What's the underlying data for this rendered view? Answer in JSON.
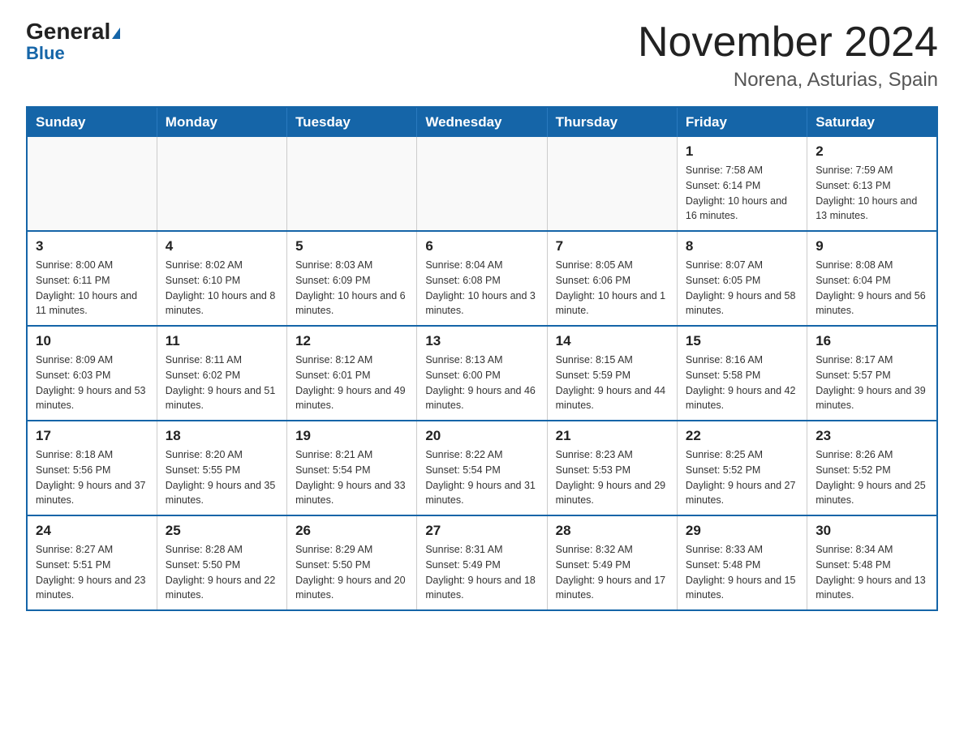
{
  "header": {
    "logo_general": "General",
    "logo_blue": "Blue",
    "title": "November 2024",
    "subtitle": "Norena, Asturias, Spain"
  },
  "calendar": {
    "weekdays": [
      "Sunday",
      "Monday",
      "Tuesday",
      "Wednesday",
      "Thursday",
      "Friday",
      "Saturday"
    ],
    "weeks": [
      [
        {
          "day": "",
          "info": ""
        },
        {
          "day": "",
          "info": ""
        },
        {
          "day": "",
          "info": ""
        },
        {
          "day": "",
          "info": ""
        },
        {
          "day": "",
          "info": ""
        },
        {
          "day": "1",
          "info": "Sunrise: 7:58 AM\nSunset: 6:14 PM\nDaylight: 10 hours and 16 minutes."
        },
        {
          "day": "2",
          "info": "Sunrise: 7:59 AM\nSunset: 6:13 PM\nDaylight: 10 hours and 13 minutes."
        }
      ],
      [
        {
          "day": "3",
          "info": "Sunrise: 8:00 AM\nSunset: 6:11 PM\nDaylight: 10 hours and 11 minutes."
        },
        {
          "day": "4",
          "info": "Sunrise: 8:02 AM\nSunset: 6:10 PM\nDaylight: 10 hours and 8 minutes."
        },
        {
          "day": "5",
          "info": "Sunrise: 8:03 AM\nSunset: 6:09 PM\nDaylight: 10 hours and 6 minutes."
        },
        {
          "day": "6",
          "info": "Sunrise: 8:04 AM\nSunset: 6:08 PM\nDaylight: 10 hours and 3 minutes."
        },
        {
          "day": "7",
          "info": "Sunrise: 8:05 AM\nSunset: 6:06 PM\nDaylight: 10 hours and 1 minute."
        },
        {
          "day": "8",
          "info": "Sunrise: 8:07 AM\nSunset: 6:05 PM\nDaylight: 9 hours and 58 minutes."
        },
        {
          "day": "9",
          "info": "Sunrise: 8:08 AM\nSunset: 6:04 PM\nDaylight: 9 hours and 56 minutes."
        }
      ],
      [
        {
          "day": "10",
          "info": "Sunrise: 8:09 AM\nSunset: 6:03 PM\nDaylight: 9 hours and 53 minutes."
        },
        {
          "day": "11",
          "info": "Sunrise: 8:11 AM\nSunset: 6:02 PM\nDaylight: 9 hours and 51 minutes."
        },
        {
          "day": "12",
          "info": "Sunrise: 8:12 AM\nSunset: 6:01 PM\nDaylight: 9 hours and 49 minutes."
        },
        {
          "day": "13",
          "info": "Sunrise: 8:13 AM\nSunset: 6:00 PM\nDaylight: 9 hours and 46 minutes."
        },
        {
          "day": "14",
          "info": "Sunrise: 8:15 AM\nSunset: 5:59 PM\nDaylight: 9 hours and 44 minutes."
        },
        {
          "day": "15",
          "info": "Sunrise: 8:16 AM\nSunset: 5:58 PM\nDaylight: 9 hours and 42 minutes."
        },
        {
          "day": "16",
          "info": "Sunrise: 8:17 AM\nSunset: 5:57 PM\nDaylight: 9 hours and 39 minutes."
        }
      ],
      [
        {
          "day": "17",
          "info": "Sunrise: 8:18 AM\nSunset: 5:56 PM\nDaylight: 9 hours and 37 minutes."
        },
        {
          "day": "18",
          "info": "Sunrise: 8:20 AM\nSunset: 5:55 PM\nDaylight: 9 hours and 35 minutes."
        },
        {
          "day": "19",
          "info": "Sunrise: 8:21 AM\nSunset: 5:54 PM\nDaylight: 9 hours and 33 minutes."
        },
        {
          "day": "20",
          "info": "Sunrise: 8:22 AM\nSunset: 5:54 PM\nDaylight: 9 hours and 31 minutes."
        },
        {
          "day": "21",
          "info": "Sunrise: 8:23 AM\nSunset: 5:53 PM\nDaylight: 9 hours and 29 minutes."
        },
        {
          "day": "22",
          "info": "Sunrise: 8:25 AM\nSunset: 5:52 PM\nDaylight: 9 hours and 27 minutes."
        },
        {
          "day": "23",
          "info": "Sunrise: 8:26 AM\nSunset: 5:52 PM\nDaylight: 9 hours and 25 minutes."
        }
      ],
      [
        {
          "day": "24",
          "info": "Sunrise: 8:27 AM\nSunset: 5:51 PM\nDaylight: 9 hours and 23 minutes."
        },
        {
          "day": "25",
          "info": "Sunrise: 8:28 AM\nSunset: 5:50 PM\nDaylight: 9 hours and 22 minutes."
        },
        {
          "day": "26",
          "info": "Sunrise: 8:29 AM\nSunset: 5:50 PM\nDaylight: 9 hours and 20 minutes."
        },
        {
          "day": "27",
          "info": "Sunrise: 8:31 AM\nSunset: 5:49 PM\nDaylight: 9 hours and 18 minutes."
        },
        {
          "day": "28",
          "info": "Sunrise: 8:32 AM\nSunset: 5:49 PM\nDaylight: 9 hours and 17 minutes."
        },
        {
          "day": "29",
          "info": "Sunrise: 8:33 AM\nSunset: 5:48 PM\nDaylight: 9 hours and 15 minutes."
        },
        {
          "day": "30",
          "info": "Sunrise: 8:34 AM\nSunset: 5:48 PM\nDaylight: 9 hours and 13 minutes."
        }
      ]
    ]
  }
}
